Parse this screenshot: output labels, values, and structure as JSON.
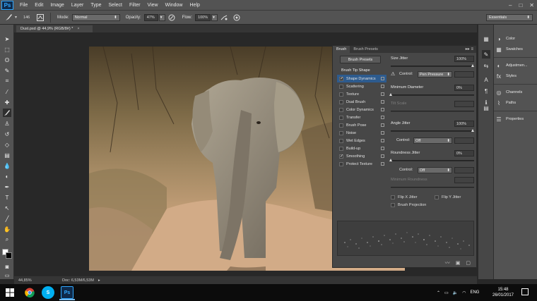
{
  "app": {
    "logo": "Ps"
  },
  "menu": [
    "File",
    "Edit",
    "Image",
    "Layer",
    "Type",
    "Select",
    "Filter",
    "View",
    "Window",
    "Help"
  ],
  "window_controls": {
    "minimize": "–",
    "maximize": "□",
    "close": "✕"
  },
  "options": {
    "brush_size": "146",
    "mode_label": "Mode:",
    "mode_value": "Normal",
    "opacity_label": "Opacity:",
    "opacity_value": "47%",
    "flow_label": "Flow:",
    "flow_value": "100%",
    "workspace": "Essentials"
  },
  "document_tab": {
    "title": "Dust.psd @ 44,9% (RGB/8#) *",
    "close": "×"
  },
  "brush_panel": {
    "tabs": [
      "Brush",
      "Brush Presets"
    ],
    "presets_button": "Brush Presets",
    "section_head": "Brush Tip Shape",
    "items": [
      {
        "label": "Shape Dynamics",
        "checked": true,
        "selected": true
      },
      {
        "label": "Scattering",
        "checked": false
      },
      {
        "label": "Texture",
        "checked": false
      },
      {
        "label": "Dual Brush",
        "checked": false
      },
      {
        "label": "Color Dynamics",
        "checked": false
      },
      {
        "label": "Transfer",
        "checked": false
      },
      {
        "label": "Brush Pose",
        "checked": false
      },
      {
        "label": "Noise",
        "checked": false
      },
      {
        "label": "Wet Edges",
        "checked": false
      },
      {
        "label": "Build-up",
        "checked": false
      },
      {
        "label": "Smoothing",
        "checked": true
      },
      {
        "label": "Protect Texture",
        "checked": false
      }
    ],
    "size_jitter_label": "Size Jitter",
    "size_jitter_value": "100%",
    "control_label": "Control:",
    "control_pen_value": "Pen Pressure",
    "min_diameter_label": "Minimum Diameter",
    "min_diameter_value": "0%",
    "tilt_scale_label": "Tilt Scale",
    "angle_jitter_label": "Angle Jitter",
    "angle_jitter_value": "100%",
    "angle_control_value": "Off",
    "roundness_jitter_label": "Roundness Jitter",
    "roundness_jitter_value": "0%",
    "roundness_control_value": "Off",
    "min_roundness_label": "Minimum Roundness",
    "flip_x_label": "Flip X Jitter",
    "flip_y_label": "Flip Y Jitter",
    "brush_projection_label": "Brush Projection"
  },
  "dock": {
    "items": [
      {
        "label": "Color",
        "icon": "color-wheel-icon"
      },
      {
        "label": "Swatches",
        "icon": "swatches-icon"
      },
      {
        "label": "Adjustmen...",
        "icon": "adjustments-icon"
      },
      {
        "label": "Styles",
        "icon": "styles-icon"
      },
      {
        "label": "Channels",
        "icon": "channels-icon"
      },
      {
        "label": "Paths",
        "icon": "paths-icon"
      },
      {
        "label": "Properties",
        "icon": "properties-icon"
      }
    ]
  },
  "status": {
    "zoom": "44,85%",
    "doc": "Doc: 6,53M/6,53M"
  },
  "taskbar": {
    "lang": "ENG",
    "time": "15:48",
    "date": "26/01/2017"
  }
}
